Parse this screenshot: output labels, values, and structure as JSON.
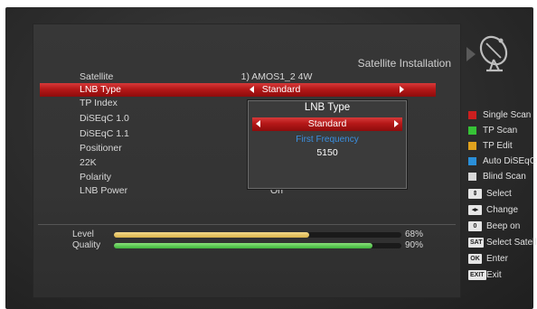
{
  "panel": {
    "title": "Satellite Installation"
  },
  "settings": [
    {
      "label": "Satellite",
      "value": "1) AMOS1_2 4W"
    },
    {
      "label": "LNB Type",
      "value": "Standard"
    },
    {
      "label": "TP Index",
      "value": ""
    },
    {
      "label": "DiSEqC 1.0",
      "value": ""
    },
    {
      "label": "DiSEqC 1.1",
      "value": ""
    },
    {
      "label": "Positioner",
      "value": ""
    },
    {
      "label": "22K",
      "value": ""
    },
    {
      "label": "Polarity",
      "value": ""
    },
    {
      "label": "LNB Power",
      "value": "On"
    }
  ],
  "popup": {
    "title": "LNB Type",
    "selected": "Standard",
    "freq_label": "First Frequency",
    "freq_value": "5150"
  },
  "signal": {
    "level_label": "Level",
    "level_percent": 68,
    "level_text": "68%",
    "quality_label": "Quality",
    "quality_percent": 90,
    "quality_text": "90%"
  },
  "help": [
    {
      "kind": "color",
      "color": "#cc1f1f",
      "label": "Single Scan"
    },
    {
      "kind": "color",
      "color": "#36c236",
      "label": "TP Scan"
    },
    {
      "kind": "color",
      "color": "#e0a21e",
      "label": "TP Edit"
    },
    {
      "kind": "color",
      "color": "#2a8fd8",
      "label": "Auto DiSEqC"
    },
    {
      "kind": "color",
      "color": "#d8d8d8",
      "label": "Blind Scan"
    },
    {
      "kind": "key",
      "key": "⇕",
      "label": "Select"
    },
    {
      "kind": "key",
      "key": "◂▸",
      "label": "Change"
    },
    {
      "kind": "key",
      "key": "0",
      "label": "Beep on"
    },
    {
      "kind": "key",
      "key": "SAT",
      "label": "Select Satellite"
    },
    {
      "kind": "key",
      "key": "OK",
      "label": "Enter"
    },
    {
      "kind": "key",
      "key": "EXIT",
      "label": "Exit"
    }
  ]
}
